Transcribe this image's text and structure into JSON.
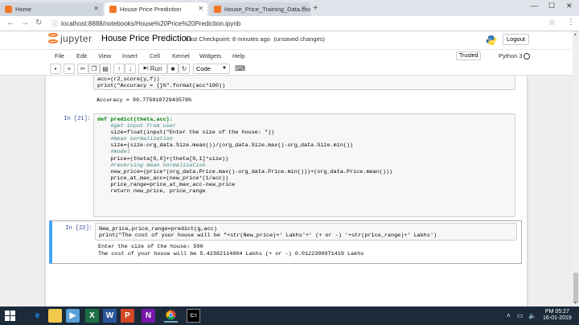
{
  "browser": {
    "tabs": [
      {
        "label": "Home"
      },
      {
        "label": "House Price Prediction"
      },
      {
        "label": "House_Price_Training_Data.csv"
      }
    ],
    "url": "localhost:8888/notebooks/House%20Price%20Prediction.ipynb"
  },
  "header": {
    "logo_text": "jupyter",
    "notebook_name": "House Price Prediction",
    "checkpoint": "Last Checkpoint: 8 minutes ago",
    "save_status": "(unsaved changes)",
    "logout_label": "Logout"
  },
  "menu": {
    "items": [
      "File",
      "Edit",
      "View",
      "Insert",
      "Cell",
      "Kernel",
      "Widgets",
      "Help"
    ],
    "trusted": "Trusted",
    "kernel": "Python 3"
  },
  "toolbar": {
    "run_label": "Run",
    "cell_type": "Code"
  },
  "cells": {
    "first": {
      "line1": "acc=(r2_score(y,f))",
      "line2": "print(\"Accuracy = {}%\".format(acc*100))",
      "output": "Accuracy = 99.77501872943576%"
    },
    "second": {
      "prompt": "In [21]:",
      "lines": [
        "def predict(theta,acc):",
        "    #get input from user",
        "    size=float(input(\"Enter the size of the house: \"))",
        "    #mean normalization",
        "    size=(size-org_data.Size.mean())/(org_data.Size.max()-org_data.Size.min())",
        "    #model",
        "    price=(theta[0,0]+(theta[0,1]*size))",
        "    #reversing mean normalization",
        "    new_price=(price*(org_data.Price.max()-org_data.Price.min()))+(org_data.Price.mean()))",
        "",
        "    price_at_max_acc=(new_price*(1/acc))",
        "    price_range=price_at_max_acc-new_price",
        "",
        "    return new_price, price_range"
      ]
    },
    "third": {
      "prompt": "In [22]:",
      "lines": [
        "New_price,price_range=predict(g,acc)",
        "print(\"The cost of your house will be \"+str(New_price)+' Lakhs'+' (+ or -) '+str(price_range)+' Lakhs')"
      ],
      "output_lines": [
        "Enter the size of the house: 500",
        "The cost of your house will be 5.42382114004 Lakhs (+ or -) 0.0122300971419 Lakhs"
      ]
    }
  },
  "taskbar": {
    "time": "PM 05:27",
    "date": "16-01-2019"
  }
}
